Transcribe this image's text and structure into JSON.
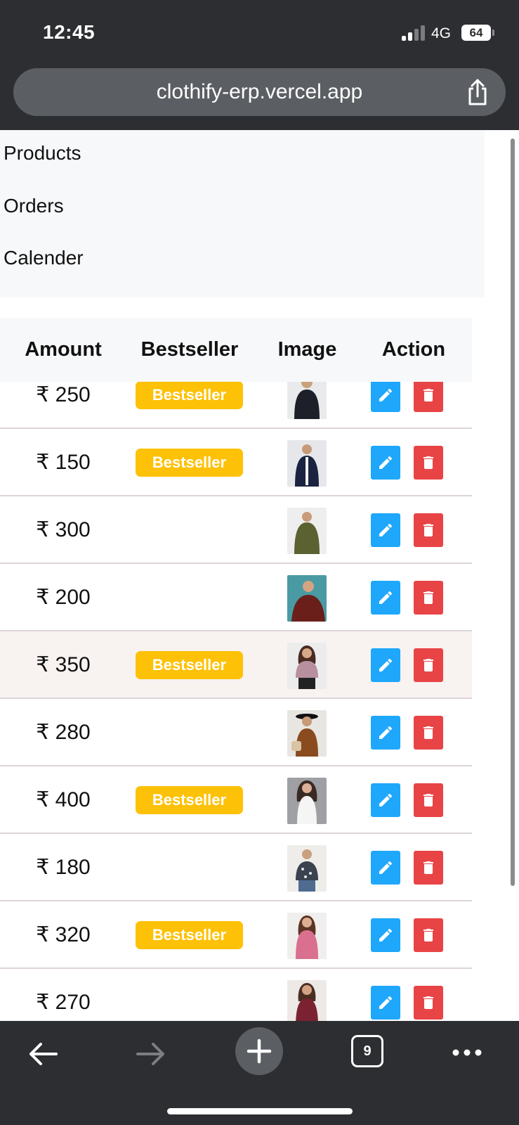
{
  "status_bar": {
    "time": "12:45",
    "network": "4G",
    "battery": "64"
  },
  "browser": {
    "url": "clothify-erp.vercel.app",
    "tab_count": "9"
  },
  "nav": {
    "items": [
      "Products",
      "Orders",
      "Calender"
    ]
  },
  "table": {
    "headers": {
      "amount": "Amount",
      "bestseller": "Bestseller",
      "image": "Image",
      "action": "Action"
    },
    "rows": [
      {
        "amount": "₹ 250",
        "badge": "Bestseller"
      },
      {
        "amount": "₹ 150",
        "badge": "Bestseller"
      },
      {
        "amount": "₹ 300",
        "badge": ""
      },
      {
        "amount": "₹ 200",
        "badge": ""
      },
      {
        "amount": "₹ 350",
        "badge": "Bestseller"
      },
      {
        "amount": "₹ 280",
        "badge": ""
      },
      {
        "amount": "₹ 400",
        "badge": "Bestseller"
      },
      {
        "amount": "₹ 180",
        "badge": ""
      },
      {
        "amount": "₹ 320",
        "badge": "Bestseller"
      },
      {
        "amount": "₹ 270",
        "badge": ""
      }
    ]
  },
  "colors": {
    "badge": "#fdc107",
    "edit_button": "#1ea7fb",
    "delete_button": "#e84446",
    "chrome": "#2c2e31"
  },
  "icons": {
    "edit": "pencil-icon",
    "delete": "trash-icon",
    "share": "share-icon",
    "back": "arrow-left-icon",
    "forward": "arrow-right-icon",
    "new_tab": "plus-icon",
    "more": "ellipsis-icon"
  }
}
